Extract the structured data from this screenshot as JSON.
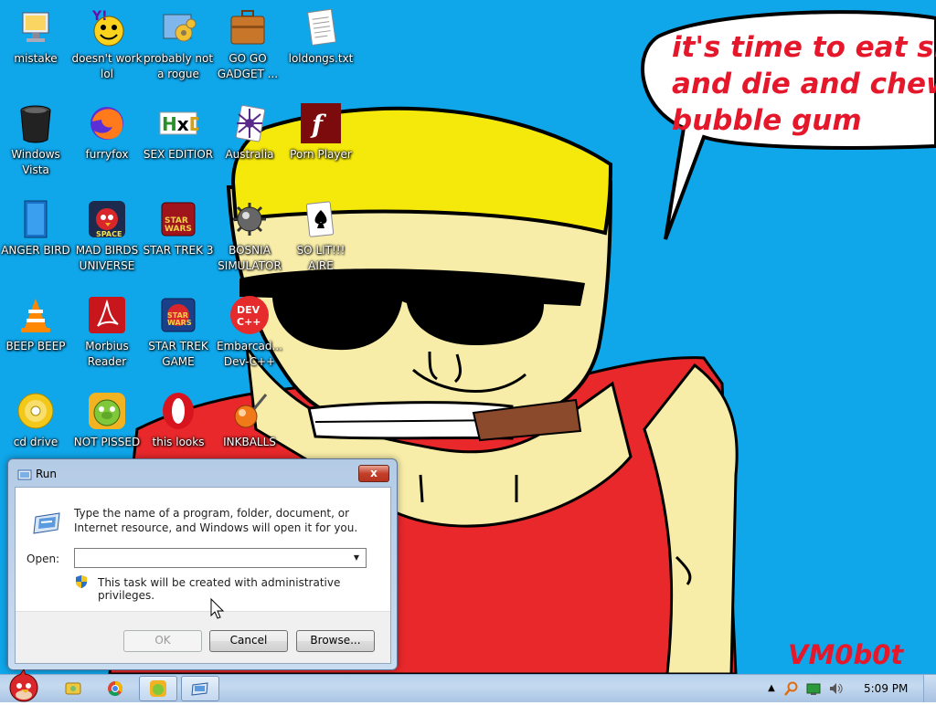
{
  "wallpaper": {
    "speech_bubble": [
      "it's time to eat shit",
      "and die and chew",
      "bubble gum"
    ],
    "signature": "VM0b0t"
  },
  "desktop_icons": [
    {
      "label": "mistake",
      "icon": "computer-icon"
    },
    {
      "label": "doesn't work lol",
      "icon": "yahoo-messenger-icon"
    },
    {
      "label": "probably not a rogue",
      "icon": "control-panel-icon"
    },
    {
      "label": "GO GO GADGET ...",
      "icon": "briefcase-icon"
    },
    {
      "label": "loldongs.txt",
      "icon": "text-file-icon"
    },
    {
      "label": "Windows Vista",
      "icon": "recycle-bin-icon"
    },
    {
      "label": "furryfox",
      "icon": "firefox-icon"
    },
    {
      "label": "SEX EDITIOR",
      "icon": "hex-editor-icon"
    },
    {
      "label": "Australia",
      "icon": "spider-solitaire-icon"
    },
    {
      "label": "Porn Player",
      "icon": "flash-player-icon"
    },
    {
      "label": "ANGER BIRD",
      "icon": "blue-book-icon"
    },
    {
      "label": "MAD BIRDS UNIVERSE",
      "icon": "angry-birds-space-icon"
    },
    {
      "label": "STAR TREK 3",
      "icon": "star-wars-icon"
    },
    {
      "label": "BOSNIA SIMULATOR",
      "icon": "mine-icon"
    },
    {
      "label": "SO LIT!!! AIRE",
      "icon": "solitaire-icon"
    },
    {
      "label": "BEEP BEEP",
      "icon": "vlc-icon"
    },
    {
      "label": "Morbius Reader",
      "icon": "adobe-reader-icon"
    },
    {
      "label": "STAR TREK GAME",
      "icon": "star-wars-game-icon"
    },
    {
      "label": "Embarcad... Dev-C++",
      "icon": "dev-cpp-icon"
    },
    {
      "label": "cd drive",
      "icon": "cd-drive-icon"
    },
    {
      "label": "NOT PISSED",
      "icon": "bad-piggies-icon"
    },
    {
      "label": "this looks",
      "icon": "opera-icon"
    },
    {
      "label": "INKBALLS",
      "icon": "inkball-icon"
    }
  ],
  "run_dialog": {
    "title": "Run",
    "description": "Type the name of a program, folder, document, or Internet resource, and Windows will open it for you.",
    "open_label": "Open:",
    "open_value": "",
    "admin_note": "This task will be created with administrative privileges.",
    "ok_label": "OK",
    "cancel_label": "Cancel",
    "browse_label": "Browse...",
    "close_glyph": "x"
  },
  "taskbar": {
    "start_icon": "angry-bird-start-icon",
    "pinned": [
      "explorer-icon",
      "chrome-icon",
      "bad-piggies-icon",
      "run-icon"
    ],
    "tray": [
      "show-hidden-icons-icon",
      "search-icon",
      "network-icon",
      "volume-icon"
    ],
    "clock": "5:09 PM"
  },
  "colors": {
    "wallpaper": "#0fa6ea",
    "bubble_text": "#e5172b",
    "skin": "#f8eda8",
    "headband": "#f5e90b",
    "shirt": "#e8282b"
  }
}
